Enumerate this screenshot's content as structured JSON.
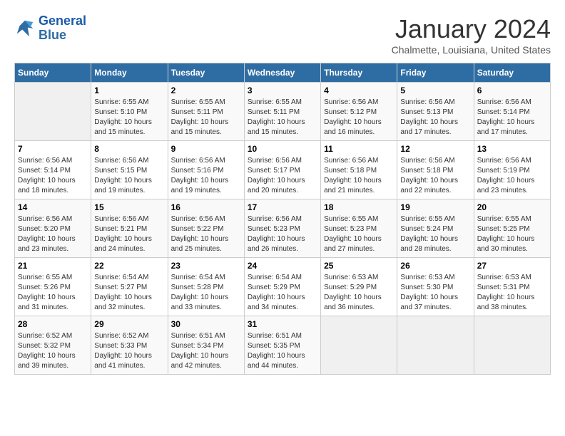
{
  "header": {
    "logo_line1": "General",
    "logo_line2": "Blue",
    "month_title": "January 2024",
    "subtitle": "Chalmette, Louisiana, United States"
  },
  "days_of_week": [
    "Sunday",
    "Monday",
    "Tuesday",
    "Wednesday",
    "Thursday",
    "Friday",
    "Saturday"
  ],
  "weeks": [
    [
      {
        "day": "",
        "info": ""
      },
      {
        "day": "1",
        "info": "Sunrise: 6:55 AM\nSunset: 5:10 PM\nDaylight: 10 hours\nand 15 minutes."
      },
      {
        "day": "2",
        "info": "Sunrise: 6:55 AM\nSunset: 5:11 PM\nDaylight: 10 hours\nand 15 minutes."
      },
      {
        "day": "3",
        "info": "Sunrise: 6:55 AM\nSunset: 5:11 PM\nDaylight: 10 hours\nand 15 minutes."
      },
      {
        "day": "4",
        "info": "Sunrise: 6:56 AM\nSunset: 5:12 PM\nDaylight: 10 hours\nand 16 minutes."
      },
      {
        "day": "5",
        "info": "Sunrise: 6:56 AM\nSunset: 5:13 PM\nDaylight: 10 hours\nand 17 minutes."
      },
      {
        "day": "6",
        "info": "Sunrise: 6:56 AM\nSunset: 5:14 PM\nDaylight: 10 hours\nand 17 minutes."
      }
    ],
    [
      {
        "day": "7",
        "info": "Sunrise: 6:56 AM\nSunset: 5:14 PM\nDaylight: 10 hours\nand 18 minutes."
      },
      {
        "day": "8",
        "info": "Sunrise: 6:56 AM\nSunset: 5:15 PM\nDaylight: 10 hours\nand 19 minutes."
      },
      {
        "day": "9",
        "info": "Sunrise: 6:56 AM\nSunset: 5:16 PM\nDaylight: 10 hours\nand 19 minutes."
      },
      {
        "day": "10",
        "info": "Sunrise: 6:56 AM\nSunset: 5:17 PM\nDaylight: 10 hours\nand 20 minutes."
      },
      {
        "day": "11",
        "info": "Sunrise: 6:56 AM\nSunset: 5:18 PM\nDaylight: 10 hours\nand 21 minutes."
      },
      {
        "day": "12",
        "info": "Sunrise: 6:56 AM\nSunset: 5:18 PM\nDaylight: 10 hours\nand 22 minutes."
      },
      {
        "day": "13",
        "info": "Sunrise: 6:56 AM\nSunset: 5:19 PM\nDaylight: 10 hours\nand 23 minutes."
      }
    ],
    [
      {
        "day": "14",
        "info": "Sunrise: 6:56 AM\nSunset: 5:20 PM\nDaylight: 10 hours\nand 23 minutes."
      },
      {
        "day": "15",
        "info": "Sunrise: 6:56 AM\nSunset: 5:21 PM\nDaylight: 10 hours\nand 24 minutes."
      },
      {
        "day": "16",
        "info": "Sunrise: 6:56 AM\nSunset: 5:22 PM\nDaylight: 10 hours\nand 25 minutes."
      },
      {
        "day": "17",
        "info": "Sunrise: 6:56 AM\nSunset: 5:23 PM\nDaylight: 10 hours\nand 26 minutes."
      },
      {
        "day": "18",
        "info": "Sunrise: 6:55 AM\nSunset: 5:23 PM\nDaylight: 10 hours\nand 27 minutes."
      },
      {
        "day": "19",
        "info": "Sunrise: 6:55 AM\nSunset: 5:24 PM\nDaylight: 10 hours\nand 28 minutes."
      },
      {
        "day": "20",
        "info": "Sunrise: 6:55 AM\nSunset: 5:25 PM\nDaylight: 10 hours\nand 30 minutes."
      }
    ],
    [
      {
        "day": "21",
        "info": "Sunrise: 6:55 AM\nSunset: 5:26 PM\nDaylight: 10 hours\nand 31 minutes."
      },
      {
        "day": "22",
        "info": "Sunrise: 6:54 AM\nSunset: 5:27 PM\nDaylight: 10 hours\nand 32 minutes."
      },
      {
        "day": "23",
        "info": "Sunrise: 6:54 AM\nSunset: 5:28 PM\nDaylight: 10 hours\nand 33 minutes."
      },
      {
        "day": "24",
        "info": "Sunrise: 6:54 AM\nSunset: 5:29 PM\nDaylight: 10 hours\nand 34 minutes."
      },
      {
        "day": "25",
        "info": "Sunrise: 6:53 AM\nSunset: 5:29 PM\nDaylight: 10 hours\nand 36 minutes."
      },
      {
        "day": "26",
        "info": "Sunrise: 6:53 AM\nSunset: 5:30 PM\nDaylight: 10 hours\nand 37 minutes."
      },
      {
        "day": "27",
        "info": "Sunrise: 6:53 AM\nSunset: 5:31 PM\nDaylight: 10 hours\nand 38 minutes."
      }
    ],
    [
      {
        "day": "28",
        "info": "Sunrise: 6:52 AM\nSunset: 5:32 PM\nDaylight: 10 hours\nand 39 minutes."
      },
      {
        "day": "29",
        "info": "Sunrise: 6:52 AM\nSunset: 5:33 PM\nDaylight: 10 hours\nand 41 minutes."
      },
      {
        "day": "30",
        "info": "Sunrise: 6:51 AM\nSunset: 5:34 PM\nDaylight: 10 hours\nand 42 minutes."
      },
      {
        "day": "31",
        "info": "Sunrise: 6:51 AM\nSunset: 5:35 PM\nDaylight: 10 hours\nand 44 minutes."
      },
      {
        "day": "",
        "info": ""
      },
      {
        "day": "",
        "info": ""
      },
      {
        "day": "",
        "info": ""
      }
    ]
  ]
}
